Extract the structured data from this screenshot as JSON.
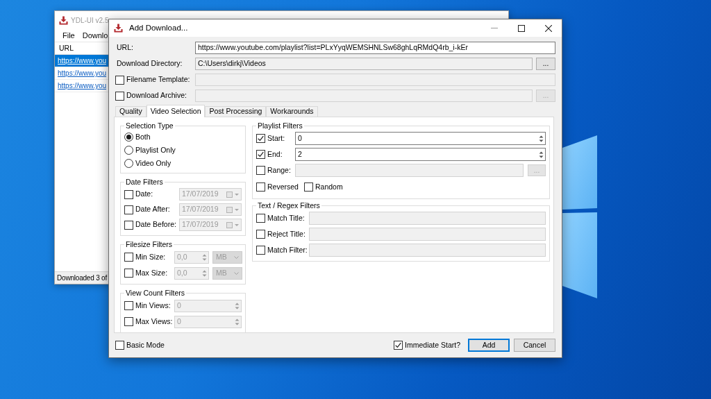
{
  "background_window": {
    "title": "YDL-UI v2.5",
    "menu": [
      "File",
      "Downlo"
    ],
    "table": {
      "columns": [
        "URL"
      ],
      "rows": [
        {
          "url": "https://www.you",
          "selected": true
        },
        {
          "url": "https://www.you",
          "selected": false
        },
        {
          "url": "https://www.you",
          "selected": false
        }
      ]
    },
    "status_bar": "Downloaded 3 of"
  },
  "dialog": {
    "title": "Add Download...",
    "fields": [
      {
        "kind": "plain",
        "label": "URL:",
        "value": "https://www.youtube.com/playlist?list=PLxYyqWEMSHNLSw68ghLqRMdQ4rb_i-kEr",
        "readonly": false,
        "disabled": false
      },
      {
        "kind": "plain",
        "label": "Download Directory:",
        "value": "C:\\Users\\dirkj\\Videos",
        "readonly": true,
        "disabled": false,
        "browse": {
          "label": "...",
          "disabled": false
        }
      },
      {
        "kind": "checkbox",
        "label": "Filename Template:",
        "checked": false,
        "disabled": true
      },
      {
        "kind": "checkbox",
        "label": "Download Archive:",
        "checked": false,
        "disabled": true,
        "browse": {
          "label": "...",
          "disabled": true
        }
      }
    ],
    "tabs": [
      {
        "label": "Quality",
        "selected": false
      },
      {
        "label": "Video Selection",
        "selected": true
      },
      {
        "label": "Post Processing",
        "selected": false
      },
      {
        "label": "Workarounds",
        "selected": false
      }
    ],
    "left_groups": [
      {
        "title": "Selection Type",
        "rows": [
          {
            "kind": "radio",
            "label": "Both",
            "selected": true
          },
          {
            "kind": "radio",
            "label": "Playlist Only",
            "selected": false
          },
          {
            "kind": "radio",
            "label": "Video Only",
            "selected": false
          }
        ]
      },
      {
        "title": "Date Filters",
        "rows": [
          {
            "kind": "date",
            "label": "Date:",
            "checked": false,
            "value": "17/07/2019",
            "disabled": true
          },
          {
            "kind": "date",
            "label": "Date After:",
            "checked": false,
            "value": "17/07/2019",
            "disabled": true
          },
          {
            "kind": "date",
            "label": "Date Before:",
            "checked": false,
            "value": "17/07/2019",
            "disabled": true
          }
        ]
      },
      {
        "title": "Filesize Filters",
        "rows": [
          {
            "kind": "size",
            "label": "Min Size:",
            "checked": false,
            "value": "0,0",
            "unit": "MB",
            "disabled": true
          },
          {
            "kind": "size",
            "label": "Max Size:",
            "checked": false,
            "value": "0,0",
            "unit": "MB",
            "disabled": true
          }
        ]
      },
      {
        "title": "View Count Filters",
        "rows": [
          {
            "kind": "number",
            "label": "Min Views:",
            "checked": false,
            "value": "0",
            "disabled": true
          },
          {
            "kind": "number",
            "label": "Max Views:",
            "checked": false,
            "value": "0",
            "disabled": true
          }
        ]
      }
    ],
    "right_groups": [
      {
        "title": "Playlist Filters",
        "rows": [
          {
            "kind": "number",
            "label": "Start:",
            "checked": true,
            "value": "0",
            "disabled": false
          },
          {
            "kind": "number",
            "label": "End:",
            "checked": true,
            "value": "2",
            "disabled": false
          },
          {
            "kind": "text",
            "label": "Range:",
            "checked": false,
            "disabled": true,
            "browse": {
              "label": "...",
              "disabled": true
            }
          },
          {
            "kind": "options",
            "items": [
              {
                "label": "Reversed",
                "checked": false
              },
              {
                "label": "Random",
                "checked": false
              }
            ]
          }
        ]
      },
      {
        "title": "Text / Regex Filters",
        "rows": [
          {
            "kind": "text",
            "label": "Match Title:",
            "checked": false,
            "disabled": true
          },
          {
            "kind": "text",
            "label": "Reject Title:",
            "checked": false,
            "disabled": true
          },
          {
            "kind": "text",
            "label": "Match Filter:",
            "checked": false,
            "disabled": true
          }
        ]
      }
    ],
    "footer": {
      "basic_mode": {
        "label": "Basic Mode",
        "checked": false
      },
      "immediate_start": {
        "label": "Immediate Start?",
        "checked": true
      },
      "buttons": [
        {
          "label": "Add",
          "default": true
        },
        {
          "label": "Cancel",
          "default": false
        }
      ]
    }
  }
}
